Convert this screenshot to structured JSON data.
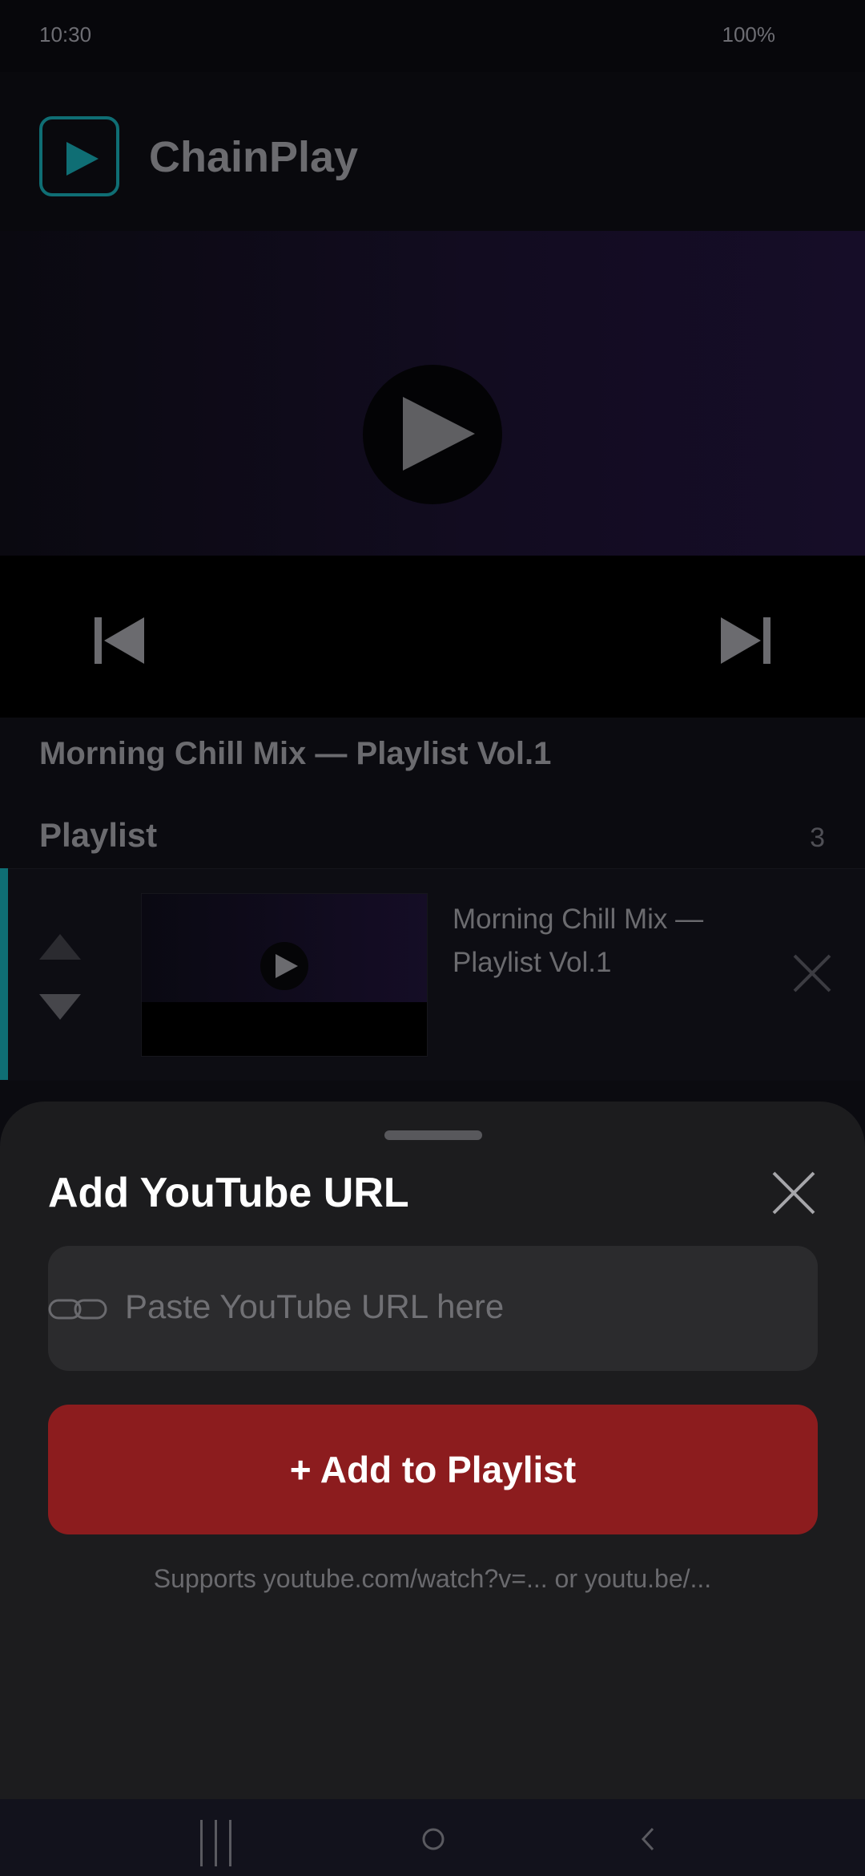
{
  "status_bar": {
    "time": "10:30",
    "battery": "100%"
  },
  "header": {
    "app_name": "ChainPlay",
    "logo_icon": "play-icon"
  },
  "player": {
    "now_playing_title": "Morning Chill Mix — Playlist Vol.1",
    "icons": {
      "play": "play-icon",
      "previous": "skip-previous-icon",
      "next": "skip-next-icon"
    }
  },
  "playlist": {
    "heading": "Playlist",
    "count": "3",
    "items": [
      {
        "title": "Morning Chill Mix — Playlist Vol.1",
        "active": true
      }
    ]
  },
  "add_sheet": {
    "title": "Add YouTube URL",
    "input_placeholder": "Paste YouTube URL here",
    "input_value": "",
    "add_button_label": "+ Add to Playlist",
    "hint": "Supports youtube.com/watch?v=... or youtu.be/..."
  },
  "colors": {
    "accent": "#0f6e74",
    "add_button": "#8c1c1e",
    "sheet_bg": "#1c1c1e"
  },
  "nav_bar": {
    "icons": [
      "recents-icon",
      "home-icon",
      "back-icon"
    ]
  }
}
